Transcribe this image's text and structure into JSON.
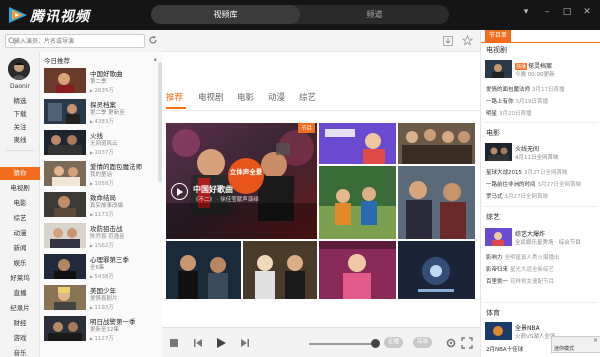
{
  "app": {
    "name": "腾讯视频"
  },
  "main_tabs": [
    "视频库",
    "频道"
  ],
  "window_controls": [
    "menu-icon",
    "minimize-icon",
    "restore-icon",
    "close-icon"
  ],
  "search": {
    "placeholder": "输入演员、片名或导演"
  },
  "user": {
    "name": "Daonir"
  },
  "categories": [
    "精选",
    "下载",
    "关注",
    "离线",
    "猜你",
    "电视剧",
    "电影",
    "综艺",
    "动漫",
    "新闻",
    "娱乐",
    "好莱坞",
    "直播",
    "纪录片",
    "财经",
    "游戏",
    "音乐"
  ],
  "active_category": "猜你",
  "recommend": {
    "header": "今日推荐",
    "items": [
      {
        "title": "中国好歌曲",
        "sub": "第二季",
        "plays": "2635万"
      },
      {
        "title": "探灵档案",
        "sub": "第二季 更新至",
        "plays": "4383万"
      },
      {
        "title": "火线",
        "sub": "无间道风云",
        "plays": "1037万"
      },
      {
        "title": "爱情的面包魔法师",
        "sub": "我的童话",
        "plays": "1058万"
      },
      {
        "title": "致命结局",
        "sub": "真实故事改编",
        "plays": "1173万"
      },
      {
        "title": "攻防狙击战",
        "sub": "陈乔恩 范逸臣",
        "plays": "1562万"
      },
      {
        "title": "心理罪第三季",
        "sub": "全6集",
        "plays": "5438万"
      },
      {
        "title": "美国少年",
        "sub": "爱情喜剧片",
        "plays": "1193万"
      },
      {
        "title": "明日战警第一季",
        "sub": "更新至12集",
        "plays": "1127万"
      }
    ]
  },
  "sub_tabs": [
    "推荐",
    "电视剧",
    "电影",
    "动漫",
    "综艺"
  ],
  "active_sub_tab": "推荐",
  "hero": {
    "title": "中国好歌曲",
    "subtitle": "《不二》 · 徐佳莹献声演绎",
    "badge": "节目",
    "circle_text": "立体声全景"
  },
  "player": {
    "pill_1": "正播",
    "pill_2": "高清"
  },
  "right_panel": {
    "tab": "节目单",
    "sections": [
      {
        "title": "电视剧",
        "featured": {
          "title": "探灵档案",
          "badge": "独播",
          "sub": "今晚 00:00更新"
        },
        "lines": [
          {
            "title": "爱情的面包魔法师",
            "date": "3月17日首播"
          },
          {
            "title": "一路上有你",
            "date": "3月19日首播"
          },
          {
            "title": "明星",
            "date": "3月20日首播"
          }
        ]
      },
      {
        "title": "电影",
        "featured": {
          "title": "火线无间",
          "badge": "",
          "sub": "4月11日全网首映"
        },
        "lines": [
          {
            "title": "星球大战2015",
            "date": "3月27日全网首映"
          },
          {
            "title": "一路前往非洲的时间",
            "date": "3月27日全网首映"
          },
          {
            "title": "罗马式",
            "date": "3月27日全网首映"
          }
        ]
      },
      {
        "title": "综艺",
        "featured": {
          "title": "综艺大爆炸",
          "badge": "",
          "sub": "全民娱乐星秀场 · 综合节目"
        },
        "lines": [
          {
            "title": "影响力",
            "date": "全明星真人秀火爆播出"
          },
          {
            "title": "影帝归来",
            "date": "星光大道全新综艺"
          },
          {
            "title": "百里挑一",
            "date": "花样男女速配节目"
          }
        ]
      },
      {
        "title": "体育",
        "featured": {
          "title": "全景NBA",
          "badge": "",
          "sub": "火箭VS湖人全场"
        },
        "lines": [
          {
            "title": "2月NBA十佳球",
            "date": ""
          }
        ]
      }
    ]
  },
  "mini_popup": {
    "label": "迷你模式"
  },
  "colors": {
    "accent": "#f26e1e",
    "titlebar": "#151515",
    "panel": "#f4f4f4"
  }
}
